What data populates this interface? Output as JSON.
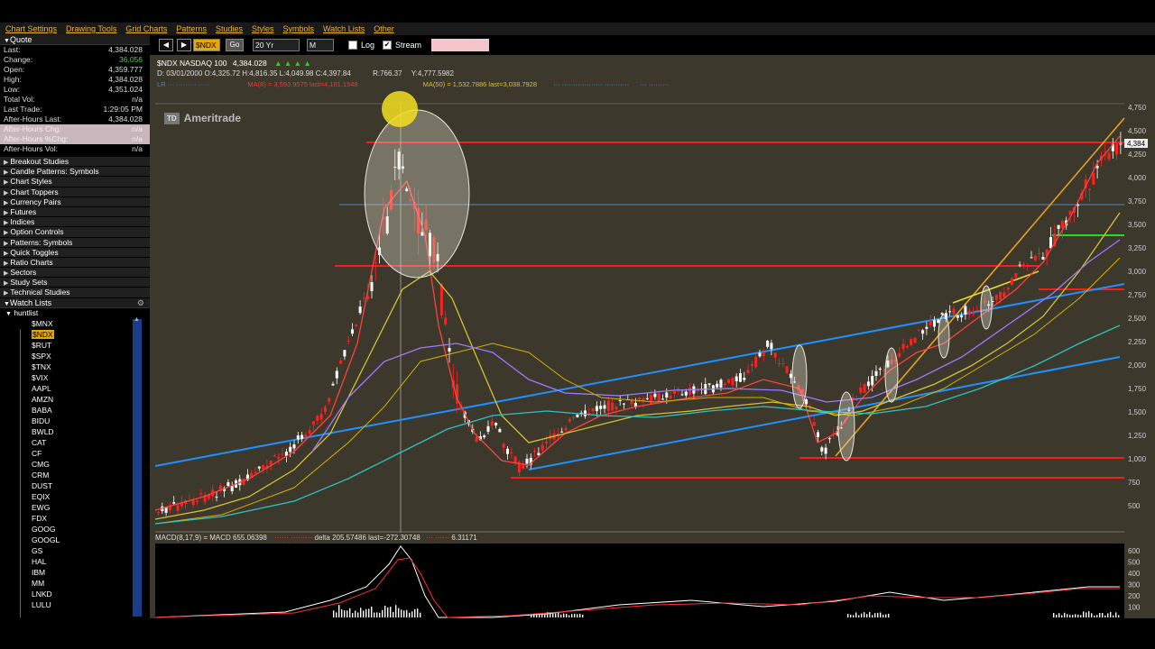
{
  "menu": [
    "Chart Settings",
    "Drawing Tools",
    "Grid Charts",
    "Patterns",
    "Studies",
    "Styles",
    "Symbols",
    "Watch Lists",
    "Other"
  ],
  "quote": {
    "header": "Quote",
    "rows": [
      {
        "label": "Last:",
        "value": "4,384.028"
      },
      {
        "label": "Change:",
        "value": "36.056"
      },
      {
        "label": "Open:",
        "value": "4,359.777"
      },
      {
        "label": "High:",
        "value": "4,384.028"
      },
      {
        "label": "Low:",
        "value": "4,351.024"
      },
      {
        "label": "Total Vol:",
        "value": "n/a"
      },
      {
        "label": "Last Trade:",
        "value": "1:29:05 PM"
      },
      {
        "label": "After-Hours Last:",
        "value": "4,384.028"
      },
      {
        "label": "After-Hours Chg:",
        "value": "n/a"
      },
      {
        "label": "After-Hours %Chg:",
        "value": "n/a"
      },
      {
        "label": "After-Hours Vol:",
        "value": "n/a"
      }
    ]
  },
  "folders": [
    "Breakout Studies",
    "Candle Patterns: Symbols",
    "Chart Styles",
    "Chart Toppers",
    "Currency Pairs",
    "Futures",
    "Indices",
    "Option Controls",
    "Patterns: Symbols",
    "Quick Toggles",
    "Ratio Charts",
    "Sectors",
    "Study Sets",
    "Technical Studies"
  ],
  "watchlists": {
    "header": "Watch Lists",
    "list_name": "huntlist",
    "symbols": [
      "$MNX",
      "$NDX",
      "$RUT",
      "$SPX",
      "$TNX",
      "$VIX",
      "AAPL",
      "AMZN",
      "BABA",
      "BIDU",
      "BWLD",
      "CAT",
      "CF",
      "CMG",
      "CRM",
      "DUST",
      "EQIX",
      "EWG",
      "FDX",
      "GOOG",
      "GOOGL",
      "GS",
      "HAL",
      "IBM",
      "MM",
      "LNKD",
      "LULU"
    ],
    "selected": "$NDX"
  },
  "toolbar": {
    "symbol": "$NDX",
    "go": "Go",
    "period": "20 Yr",
    "interval": "M",
    "log_label": "Log",
    "stream_label": "Stream",
    "log_checked": false,
    "stream_checked": true
  },
  "chart": {
    "title": "$NDX NASDAQ 100",
    "last": "4,384.028",
    "ohlc": "D: 03/01/2000 O:4,325.72 H:4,816.35 L:4,049.98 C:4,397.84",
    "range": "R:766.37",
    "y": "Y:4,777.5982",
    "logo_td": "TD",
    "logo": "Ameritrade",
    "ma_legend": "MA(8) = 3,593.9575 last=4,181.1548",
    "ma50_legend": "MA(50) = 1,532.7886 last=3,038.7928",
    "macd_label": "MACD(8,17,9) = MACD 655.06398",
    "macd_delta": "delta 205.57486 last=-272.30748",
    "macd_extra": "6.31171",
    "price_ticks": [
      "4,750",
      "4,500",
      "4,250",
      "4,000",
      "3,750",
      "3,500",
      "3,250",
      "3,000",
      "2,750",
      "2,500",
      "2,250",
      "2,000",
      "1,750",
      "1,500",
      "1,250",
      "1,000",
      "750",
      "500"
    ],
    "last_tag": "4,384",
    "macd_ticks": [
      "600",
      "500",
      "400",
      "300",
      "200",
      "100"
    ],
    "colors": {
      "bg": "#3d382c",
      "up": "#ffffff",
      "down": "#ff2020",
      "level": "#ff1a1a",
      "trend": "#1e90ff",
      "ma_fast": "#ff4040",
      "ma_mid": "#d4c030",
      "ma_slow": "#9b7bff",
      "ma_long": "#30c0c0"
    }
  }
}
